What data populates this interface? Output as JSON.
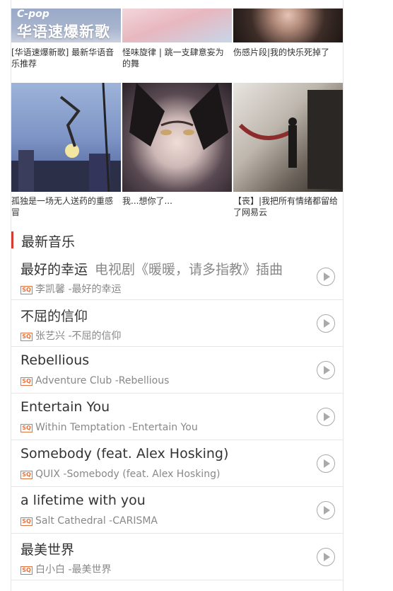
{
  "playlists": [
    {
      "cover_tag": "C-pop",
      "cover_text": "华语速爆新歌",
      "caption": "[华语速爆新歌] 最新华语音乐推荐"
    },
    {
      "caption": "怪味旋律 | 跳一支肆意妄为的舞"
    },
    {
      "caption": "伤感片段|我的快乐死掉了"
    },
    {
      "caption": "孤独是一场无人送药的重感冒"
    },
    {
      "caption": "我...想你了..."
    },
    {
      "caption": "【丧】|我把所有情绪都留给了网易云"
    }
  ],
  "section": {
    "title": "最新音乐"
  },
  "sq_badge": "SQ",
  "songs": [
    {
      "title": "最好的幸运",
      "alias": "电视剧《暖暖，请多指教》插曲",
      "meta": "李凯馨 -最好的幸运"
    },
    {
      "title": "不屈的信仰",
      "alias": "",
      "meta": "张艺兴 -不屈的信仰"
    },
    {
      "title": "Rebellious",
      "alias": "",
      "meta": "Adventure Club -Rebellious"
    },
    {
      "title": "Entertain You",
      "alias": "",
      "meta": "Within Temptation -Entertain You"
    },
    {
      "title": "Somebody (feat. Alex Hosking)",
      "alias": "",
      "meta": "QUIX -Somebody (feat. Alex Hosking)"
    },
    {
      "title": "a lifetime with you",
      "alias": "",
      "meta": "Salt Cathedral -CARISMA"
    },
    {
      "title": "最美世界",
      "alias": "",
      "meta": "白小白 -最美世界"
    }
  ],
  "colors": {
    "accent": "#d43c33",
    "sq_badge": "#e4723d",
    "text": "#333333",
    "muted": "#888888"
  }
}
